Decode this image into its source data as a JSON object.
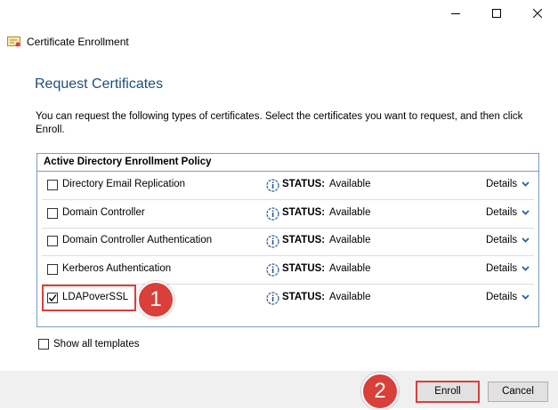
{
  "window": {
    "title": "Certificate Enrollment",
    "controls": {
      "minimize_icon": "minimize-icon",
      "maximize_icon": "maximize-icon",
      "close_icon": "close-icon"
    }
  },
  "page": {
    "heading": "Request Certificates",
    "instructions": "You can request the following types of certificates. Select the certificates you want to request, and then click Enroll."
  },
  "policy": {
    "header": "Active Directory Enrollment Policy",
    "status_label": "STATUS:",
    "details_label": "Details",
    "certificates": [
      {
        "name": "Directory Email Replication",
        "status": "Available",
        "checked": false
      },
      {
        "name": "Domain Controller",
        "status": "Available",
        "checked": false
      },
      {
        "name": "Domain Controller Authentication",
        "status": "Available",
        "checked": false
      },
      {
        "name": "Kerberos Authentication",
        "status": "Available",
        "checked": false
      },
      {
        "name": "LDAPoverSSL",
        "status": "Available",
        "checked": true
      }
    ]
  },
  "show_all_templates": {
    "label": "Show all templates",
    "checked": false
  },
  "annotations": {
    "step1": "1",
    "step2": "2",
    "highlight_color": "#d9403a"
  },
  "buttons": {
    "enroll": "Enroll",
    "cancel": "Cancel"
  },
  "colors": {
    "heading": "#1f4e79",
    "policy_border": "#7a9cc0",
    "footer_bg": "#f0f0f0"
  }
}
